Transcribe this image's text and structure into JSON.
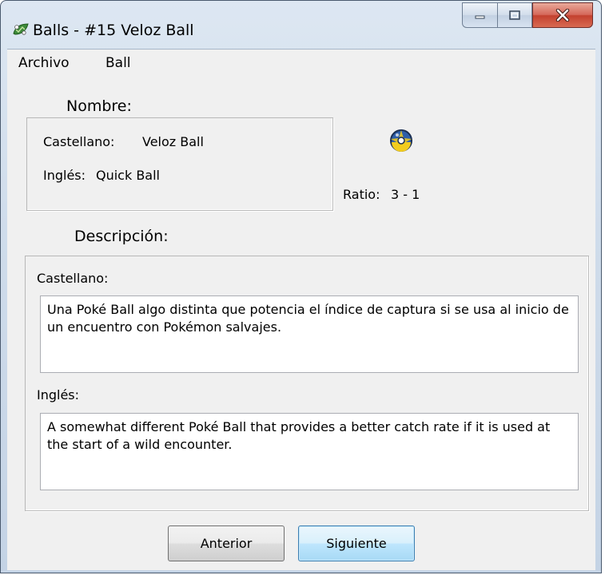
{
  "window": {
    "title": "Balls - #15 Veloz Ball",
    "app_icon": "leaf-icon"
  },
  "menu": {
    "items": [
      "Archivo",
      "Ball"
    ]
  },
  "nombre": {
    "label": "Nombre:",
    "castellano_label": "Castellano:",
    "castellano_value": "Veloz Ball",
    "ingles_label": "Inglés:",
    "ingles_value": "Quick Ball"
  },
  "ball": {
    "icon": "quick-ball-icon",
    "ratio_label": "Ratio:",
    "ratio_value": "3 - 1"
  },
  "descripcion": {
    "label": "Descripción:",
    "castellano_label": "Castellano:",
    "castellano_text": "Una Poké Ball algo distinta que potencia el índice de captura si se usa al inicio de un encuentro con Pokémon salvajes.",
    "ingles_label": "Inglés:",
    "ingles_text": "A somewhat different Poké Ball that provides a better catch rate if it is used at the start of a wild encounter."
  },
  "buttons": {
    "prev": "Anterior",
    "next": "Siguiente"
  },
  "colors": {
    "ball_yellow": "#f2cc1f",
    "ball_blue": "#2f5fa8",
    "close_red": "#c3412f"
  }
}
